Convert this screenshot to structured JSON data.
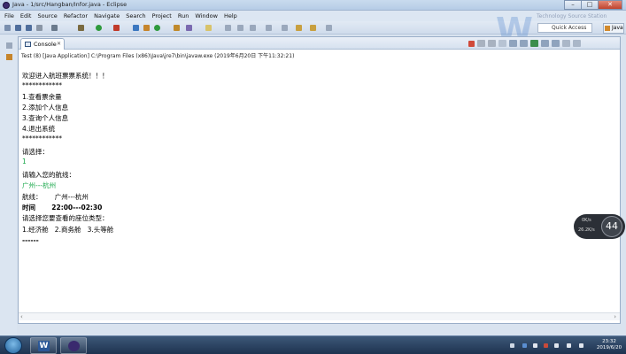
{
  "window": {
    "title": "Java - 1/src/Hangban/Infor.java - Eclipse",
    "buttons": {
      "minimize": "–",
      "maximize": "□",
      "close": "✕"
    }
  },
  "menu": [
    "File",
    "Edit",
    "Source",
    "Refactor",
    "Navigate",
    "Search",
    "Project",
    "Run",
    "Window",
    "Help"
  ],
  "toolbar": {
    "quick_access": "Quick Access",
    "perspective": "Java"
  },
  "console": {
    "tab_label": "Console",
    "tab_close": "✕",
    "status": "Test (8) [Java Application] C:\\Program Files (x86)\\Java\\jre7\\bin\\javaw.exe (2019年6月20日 下午11:32:21)",
    "lines": [
      {
        "text": "欢迎进入航班票票系统！！！",
        "type": "output"
      },
      {
        "text": "************",
        "type": "output"
      },
      {
        "text": "1.查看票余量",
        "type": "output"
      },
      {
        "text": "2.添加个人信息",
        "type": "output"
      },
      {
        "text": "3.查询个人信息",
        "type": "output"
      },
      {
        "text": "4.退出系统",
        "type": "output"
      },
      {
        "text": "************",
        "type": "output"
      },
      {
        "text": "请选择：",
        "type": "output"
      },
      {
        "text": "1",
        "type": "input"
      },
      {
        "text": "请输入您的航线：",
        "type": "output"
      },
      {
        "text": "广州---杭州",
        "type": "input"
      },
      {
        "text": "航线：      广州---杭州",
        "type": "output"
      },
      {
        "text": "时间       22:00---02:30",
        "type": "output"
      },
      {
        "text": "请选择您要查看的座位类型：",
        "type": "output"
      },
      {
        "text": "1.经济舱   2.商务舱   3.头等舱",
        "type": "output"
      },
      {
        "text": "------",
        "type": "output"
      }
    ]
  },
  "watermark": {
    "letter": "W",
    "text": "Technology Source Station"
  },
  "meter": {
    "upload": "0K/s",
    "download": "26.2K/s",
    "percent": "44"
  },
  "taskbar": {
    "clock_time": "23:32",
    "clock_date": "2019/6/20",
    "word_glyph": "W"
  },
  "colors": {
    "console_input": "#1aa84b",
    "taskbar": "#1e3350",
    "titlebar": "#c9dbee"
  }
}
